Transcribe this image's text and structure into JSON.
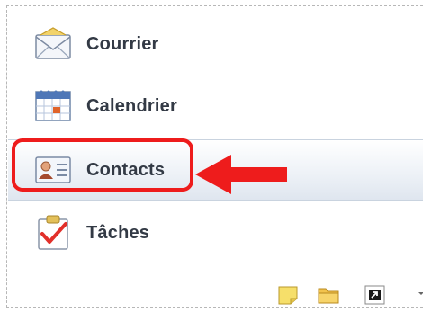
{
  "nav": {
    "items": [
      {
        "label": "Courrier",
        "icon": "mail-envelope-icon"
      },
      {
        "label": "Calendrier",
        "icon": "calendar-icon"
      },
      {
        "label": "Contacts",
        "icon": "contact-card-icon",
        "selected": true
      },
      {
        "label": "Tâches",
        "icon": "task-clipboard-icon"
      }
    ]
  },
  "toolbar": {
    "icons": [
      "notes-icon",
      "folder-icon",
      "shortcut-icon",
      "configure-buttons-chevron-icon"
    ]
  },
  "annotation": {
    "highlight_color": "#ee1c1c",
    "arrow_color": "#ee1c1c",
    "target": "Contacts"
  },
  "colors": {
    "label_text": "#333a45",
    "selected_background": "#e6ecf3"
  }
}
